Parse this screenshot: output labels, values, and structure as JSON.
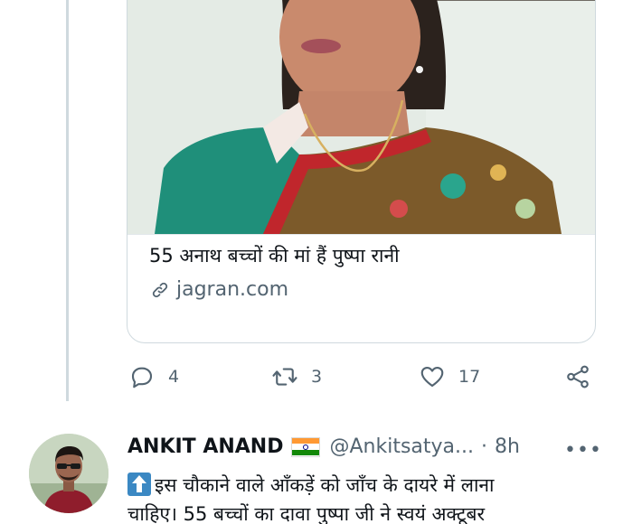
{
  "link_card": {
    "title": "55 अनाथ बच्चों की मां हैं पुष्पा रानी",
    "domain": "jagran.com"
  },
  "tweet_actions": {
    "reply_count": "4",
    "retweet_count": "3",
    "like_count": "17"
  },
  "reply_tweet": {
    "author_name": "ANKIT ANAND",
    "author_flag": "indian-flag-emoji",
    "handle": "@Ankitsatya...",
    "separator": "·",
    "time": "8h",
    "more": "•••",
    "text_line1": "इस चौकाने वाले आँकड़ें को जाँच के दायरे में लाना",
    "text_line2": "चाहिए। 55 बच्चों का दावा पुष्पा जी ने स्वयं अक्टूबर"
  },
  "colors": {
    "secondary_text": "#536471",
    "border": "#cfd9de",
    "emoji_blue": "#3b88c3"
  }
}
